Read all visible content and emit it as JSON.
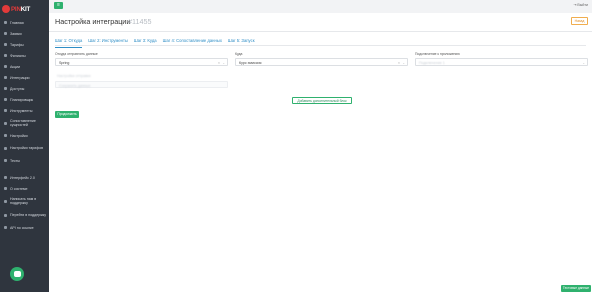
{
  "brand": {
    "logo_text_a": "PIN",
    "logo_text_b": "KIT"
  },
  "sidebar": {
    "items": [
      {
        "label": "Главная",
        "icon": "home-icon"
      },
      {
        "label": "Заявки",
        "icon": "inbox-icon"
      },
      {
        "label": "Тарифы",
        "icon": "tag-icon"
      },
      {
        "label": "Филиалы",
        "icon": "building-icon"
      },
      {
        "label": "Акции",
        "icon": "percent-icon"
      },
      {
        "label": "Интеграции",
        "icon": "plug-icon"
      },
      {
        "label": "Доступы",
        "icon": "key-icon"
      },
      {
        "label": "Планировщик",
        "icon": "calendar-icon"
      },
      {
        "label": "Инструменты",
        "icon": "wrench-icon"
      },
      {
        "label": "Сопоставление сущностей",
        "icon": "link-icon"
      },
      {
        "label": "Настройки",
        "icon": "gear-icon"
      },
      {
        "label": "Настройки тарифов",
        "icon": "sliders-icon"
      },
      {
        "label": "Тесты",
        "icon": "check-icon"
      }
    ],
    "bottom_items": [
      {
        "label": "Интерфейс 2.0",
        "icon": "monitor-icon"
      },
      {
        "label": "О системе",
        "icon": "info-icon"
      },
      {
        "label": "Написать нам в поддержку",
        "icon": "mail-icon"
      },
      {
        "label": "Перейти в поддержку",
        "icon": "help-icon"
      },
      {
        "label": "API по ссылке",
        "icon": "api-icon"
      }
    ]
  },
  "topbar": {
    "menu_symbol": "≡",
    "logout_label": "Выйти"
  },
  "header": {
    "title": "Настройка интеграции",
    "integration_id": "#11455",
    "back_label": "Назад"
  },
  "tabs": [
    {
      "label": "Шаг 1: Откуда",
      "active": true
    },
    {
      "label": "Шаг 2: Инструменты",
      "active": false
    },
    {
      "label": "Шаг 3: Куда",
      "active": false
    },
    {
      "label": "Шаг 4: Сопоставление данных",
      "active": false
    },
    {
      "label": "Шаг 5: Запуск",
      "active": false
    }
  ],
  "form": {
    "source": {
      "label": "Откуда отправлять данные",
      "value": "Spring"
    },
    "target": {
      "label": "Куда",
      "value": "Курс эмиссия"
    },
    "connection": {
      "label": "Подключение к приложению",
      "value": "Подключение 1"
    },
    "blurred_label": "Настройки отправки",
    "blurred_value": "Сохранить данные"
  },
  "buttons": {
    "add_connection": "Добавить дополнительный блок",
    "continue": "Продолжить",
    "test": "Тестовые данные"
  },
  "colors": {
    "accent": "#2fb16e",
    "link": "#2f8ec6",
    "sidebar_bg": "#2f353e",
    "brand_red": "#e23a3a",
    "warning": "#f0ad4e"
  }
}
